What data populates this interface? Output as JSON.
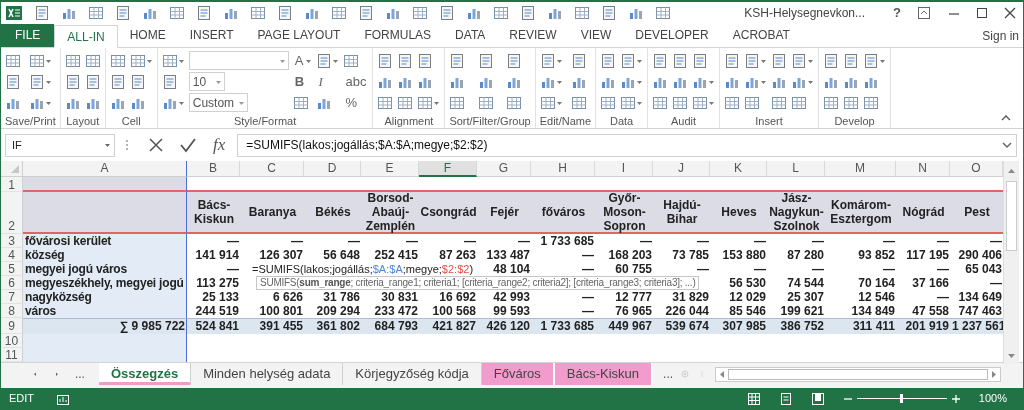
{
  "window": {
    "title": "KSH-Helysegnevkon...",
    "help": "?"
  },
  "account": {
    "label": "Sign in"
  },
  "ribbon_tabs": [
    {
      "label": "FILE",
      "kind": "file",
      "selected": false
    },
    {
      "label": "ALL-IN",
      "kind": "tab",
      "selected": true
    },
    {
      "label": "HOME",
      "kind": "tab",
      "selected": false
    },
    {
      "label": "INSERT",
      "kind": "tab",
      "selected": false
    },
    {
      "label": "PAGE LAYOUT",
      "kind": "tab",
      "selected": false
    },
    {
      "label": "FORMULAS",
      "kind": "tab",
      "selected": false
    },
    {
      "label": "DATA",
      "kind": "tab",
      "selected": false
    },
    {
      "label": "REVIEW",
      "kind": "tab",
      "selected": false
    },
    {
      "label": "VIEW",
      "kind": "tab",
      "selected": false
    },
    {
      "label": "DEVELOPER",
      "kind": "tab",
      "selected": false
    },
    {
      "label": "ACROBAT",
      "kind": "tab",
      "selected": false
    }
  ],
  "ribbon_groups": [
    {
      "label": "Save/Print",
      "tools": [
        {
          "kind": "icon",
          "dropdown": false
        },
        {
          "kind": "icon",
          "dropdown": false
        },
        {
          "kind": "icon",
          "dropdown": false
        },
        {
          "kind": "icon",
          "dropdown": true
        },
        {
          "kind": "icon",
          "dropdown": true
        },
        {
          "kind": "icon",
          "dropdown": true
        }
      ]
    },
    {
      "label": "Layout",
      "tools": [
        {
          "kind": "icon",
          "dropdown": false
        },
        {
          "kind": "icon",
          "dropdown": false
        },
        {
          "kind": "icon",
          "dropdown": false
        },
        {
          "kind": "icon",
          "dropdown": false
        },
        {
          "kind": "icon",
          "dropdown": false
        },
        {
          "kind": "icon",
          "dropdown": false
        }
      ]
    },
    {
      "label": "Cell",
      "tools": [
        {
          "kind": "icon",
          "dropdown": false
        },
        {
          "kind": "icon",
          "dropdown": false
        },
        {
          "kind": "icon",
          "dropdown": false
        },
        {
          "kind": "icon",
          "dropdown": true
        },
        {
          "kind": "icon",
          "dropdown": false
        },
        {
          "kind": "icon",
          "dropdown": false
        }
      ]
    },
    {
      "label": "Style/Format",
      "tools": [
        {
          "kind": "icon",
          "dropdown": true
        },
        {
          "kind": "icon",
          "dropdown": false
        },
        {
          "kind": "icon",
          "dropdown": true
        },
        {
          "kind": "field",
          "dropdown": true
        },
        {
          "kind": "field",
          "value": "10",
          "dropdown": true
        },
        {
          "kind": "field",
          "value": "Custom",
          "dropdown": true
        },
        {
          "kind": "glyph",
          "text": "A",
          "dropdown": true
        },
        {
          "kind": "bold-glyph",
          "text": "B",
          "dropdown": false
        },
        {
          "kind": "icon",
          "dropdown": false
        },
        {
          "kind": "icon",
          "dropdown": true
        },
        {
          "kind": "italic-glyph",
          "text": "I",
          "dropdown": false
        },
        {
          "kind": "icon",
          "dropdown": false
        },
        {
          "kind": "icon",
          "dropdown": false
        },
        {
          "kind": "glyph",
          "text": "abc",
          "dropdown": false
        },
        {
          "kind": "glyph",
          "text": "%",
          "dropdown": false
        }
      ]
    },
    {
      "label": "Alignment",
      "tools": [
        {
          "kind": "icon",
          "dropdown": false
        },
        {
          "kind": "icon",
          "dropdown": false
        },
        {
          "kind": "icon",
          "dropdown": false
        },
        {
          "kind": "icon",
          "dropdown": false
        },
        {
          "kind": "icon",
          "dropdown": false
        },
        {
          "kind": "icon",
          "dropdown": false
        },
        {
          "kind": "icon",
          "dropdown": false
        },
        {
          "kind": "icon",
          "dropdown": false
        },
        {
          "kind": "icon",
          "dropdown": true
        }
      ]
    },
    {
      "label": "Sort/Filter/Group",
      "tools": [
        {
          "kind": "icon",
          "dropdown": false
        },
        {
          "kind": "icon",
          "dropdown": false
        },
        {
          "kind": "icon",
          "dropdown": false
        },
        {
          "kind": "icon",
          "dropdown": false
        },
        {
          "kind": "icon",
          "dropdown": false
        },
        {
          "kind": "icon",
          "dropdown": false
        },
        {
          "kind": "icon",
          "dropdown": false
        },
        {
          "kind": "icon",
          "dropdown": false
        },
        {
          "kind": "icon",
          "dropdown": false
        }
      ]
    },
    {
      "label": "Edit/Name",
      "tools": [
        {
          "kind": "icon",
          "dropdown": true
        },
        {
          "kind": "icon",
          "dropdown": true
        },
        {
          "kind": "icon",
          "dropdown": true
        },
        {
          "kind": "icon",
          "dropdown": false
        },
        {
          "kind": "icon",
          "dropdown": false
        },
        {
          "kind": "icon",
          "dropdown": false
        }
      ]
    },
    {
      "label": "Data",
      "tools": [
        {
          "kind": "icon",
          "dropdown": false
        },
        {
          "kind": "icon",
          "dropdown": false
        },
        {
          "kind": "icon",
          "dropdown": false
        },
        {
          "kind": "icon",
          "dropdown": true
        },
        {
          "kind": "icon",
          "dropdown": true
        },
        {
          "kind": "icon",
          "dropdown": true
        }
      ]
    },
    {
      "label": "Audit",
      "tools": [
        {
          "kind": "icon",
          "dropdown": false
        },
        {
          "kind": "icon",
          "dropdown": false
        },
        {
          "kind": "icon",
          "dropdown": false
        },
        {
          "kind": "icon",
          "dropdown": false
        },
        {
          "kind": "icon",
          "dropdown": false
        },
        {
          "kind": "icon",
          "dropdown": false
        },
        {
          "kind": "icon",
          "dropdown": false
        },
        {
          "kind": "icon",
          "dropdown": true
        },
        {
          "kind": "icon",
          "dropdown": true
        }
      ]
    },
    {
      "label": "Insert",
      "tools": [
        {
          "kind": "icon",
          "dropdown": false
        },
        {
          "kind": "icon",
          "dropdown": false
        },
        {
          "kind": "icon",
          "dropdown": false
        },
        {
          "kind": "icon",
          "dropdown": true
        },
        {
          "kind": "icon",
          "dropdown": true
        },
        {
          "kind": "icon",
          "dropdown": false
        },
        {
          "kind": "icon",
          "dropdown": false
        },
        {
          "kind": "icon",
          "dropdown": false
        },
        {
          "kind": "icon",
          "dropdown": false
        },
        {
          "kind": "icon",
          "dropdown": true
        },
        {
          "kind": "icon",
          "dropdown": true
        },
        {
          "kind": "icon",
          "dropdown": false
        }
      ]
    },
    {
      "label": "Develop",
      "tools": [
        {
          "kind": "icon",
          "dropdown": false
        },
        {
          "kind": "icon",
          "dropdown": false
        },
        {
          "kind": "icon",
          "dropdown": false
        },
        {
          "kind": "icon",
          "dropdown": false
        },
        {
          "kind": "icon",
          "dropdown": false
        },
        {
          "kind": "icon",
          "dropdown": false
        },
        {
          "kind": "icon",
          "dropdown": true
        },
        {
          "kind": "icon",
          "dropdown": false
        },
        {
          "kind": "icon",
          "dropdown": false
        }
      ]
    }
  ],
  "name_box": {
    "value": "IF"
  },
  "formula_bar": {
    "insert_function": "fx",
    "value": "=SUMIFS(lakos;jogállás;$A:$A;megye;$2:$2)"
  },
  "sheet": {
    "columns": [
      {
        "label": "A",
        "selected": false
      },
      {
        "label": "B",
        "selected": false
      },
      {
        "label": "C",
        "selected": false
      },
      {
        "label": "D",
        "selected": false
      },
      {
        "label": "E",
        "selected": false
      },
      {
        "label": "F",
        "selected": true
      },
      {
        "label": "G",
        "selected": false
      },
      {
        "label": "H",
        "selected": false
      },
      {
        "label": "I",
        "selected": false
      },
      {
        "label": "J",
        "selected": false
      },
      {
        "label": "K",
        "selected": false
      },
      {
        "label": "L",
        "selected": false
      },
      {
        "label": "M",
        "selected": false
      },
      {
        "label": "N",
        "selected": false
      },
      {
        "label": "O",
        "selected": false
      }
    ],
    "rows": [
      {
        "number": "1",
        "kind": "spacer"
      },
      {
        "number": "2",
        "kind": "header",
        "cells": [
          null,
          "Bács-Kiskun",
          "Baranya",
          "Békés",
          "Borsod-Abaúj-Zemplén",
          "Csongrád",
          "Fejér",
          "főváros",
          "Győr-Moson-Sopron",
          "Hajdú-Bihar",
          "Heves",
          "Jász-Nagykun-Szolnok",
          "Komárom-Esztergom",
          "Nógrád",
          "Pest"
        ]
      },
      {
        "number": "3",
        "kind": "data",
        "cells": [
          "fővárosi kerület",
          "—",
          "—",
          "—",
          "—",
          "—",
          "—",
          "1 733 685",
          "—",
          "—",
          "—",
          "—",
          "—",
          "—",
          "—"
        ]
      },
      {
        "number": "4",
        "kind": "data",
        "cells": [
          "község",
          "141 914",
          "126 307",
          "56 648",
          "252 415",
          "87 263",
          "133 487",
          "—",
          "168 203",
          "73 785",
          "153 880",
          "87 280",
          "93 852",
          "117 195",
          "290 406"
        ]
      },
      {
        "number": "5",
        "kind": "data",
        "cells": [
          "megyei jogú város",
          "—",
          {
            "kind": "editor",
            "parts": [
              {
                "text": "=SUMIFS(lakos;jogállás;"
              },
              {
                "text": "$A:$A",
                "color": "#4a86d8"
              },
              {
                "text": ";megye;"
              },
              {
                "text": "$2:$2",
                "color": "#e0504a"
              },
              {
                "text": ")"
              }
            ]
          },
          null,
          null,
          null,
          "48 104",
          "—",
          "60 755",
          "—",
          "—",
          "—",
          "—",
          "—",
          "65 043"
        ]
      },
      {
        "number": "6",
        "kind": "data",
        "cells": [
          "megyeszékhely, megyei jogú",
          "113 275",
          {
            "kind": "tooltip",
            "text": "SUMIFS(**sum_range**; criteria_range1; criteria1; [criteria_range2; criteria2]; [criteria_range3; criteria3]; ...)"
          },
          null,
          null,
          null,
          null,
          null,
          null,
          null,
          "56 530",
          "74 544",
          "70 164",
          "37 166",
          "—"
        ]
      },
      {
        "number": "7",
        "kind": "data",
        "cells": [
          "nagyközség",
          "25 133",
          "6 626",
          "31 786",
          "30 831",
          "16 692",
          "42 993",
          "—",
          "12 777",
          "31 829",
          "12 029",
          "25 307",
          "12 546",
          "—",
          "134 649"
        ]
      },
      {
        "number": "8",
        "kind": "data",
        "cells": [
          "város",
          "244 519",
          "100 801",
          "209 294",
          "233 472",
          "100 568",
          "99 593",
          "—",
          "76 965",
          "226 044",
          "85 546",
          "199 621",
          "134 849",
          "47 558",
          "747 463"
        ]
      },
      {
        "number": "9",
        "kind": "total",
        "cells": [
          "∑ 9 985 722",
          "524 841",
          "391 455",
          "361 802",
          "684 793",
          "421 827",
          "426 120",
          "1 733 685",
          "449 967",
          "539 674",
          "307 985",
          "386 752",
          "311 411",
          "201 919",
          "1 237 561"
        ]
      },
      {
        "number": "10",
        "kind": "data"
      },
      {
        "number": "11",
        "kind": "data"
      }
    ]
  },
  "sheet_tabs": {
    "more_before": "...",
    "more_after": "...",
    "tabs": [
      {
        "label": "Összegzés",
        "selected": true,
        "color": "#f09cc4"
      },
      {
        "label": "Minden helység adata",
        "selected": false
      },
      {
        "label": "Körjegyzőség kódja",
        "selected": false
      },
      {
        "label": "Főváros",
        "selected": false,
        "color": "#f29ccd"
      },
      {
        "label": "Bács-Kiskun",
        "selected": false,
        "color": "#f29ccd"
      }
    ]
  },
  "status_bar": {
    "mode": "EDIT",
    "zoom": {
      "level": 0.5,
      "reading": "100%"
    }
  }
}
